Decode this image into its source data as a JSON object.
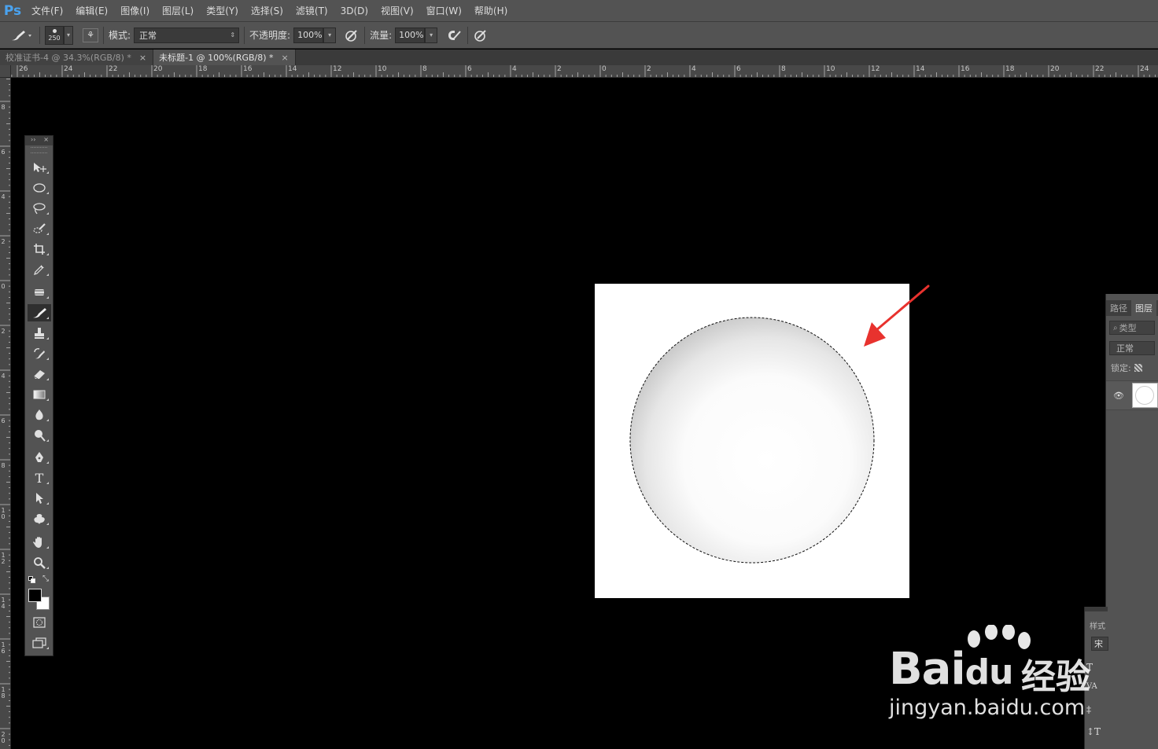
{
  "app": {
    "logo": "Ps"
  },
  "menu": [
    "文件(F)",
    "编辑(E)",
    "图像(I)",
    "图层(L)",
    "类型(Y)",
    "选择(S)",
    "滤镜(T)",
    "3D(D)",
    "视图(V)",
    "窗口(W)",
    "帮助(H)"
  ],
  "options": {
    "brush_size": "250",
    "mode_label": "模式:",
    "mode_value": "正常",
    "opacity_label": "不透明度:",
    "opacity_value": "100%",
    "flow_label": "流量:",
    "flow_value": "100%"
  },
  "tabs": [
    {
      "label": "校准证书-4 @ 34.3%(RGB/8) *",
      "close": "×",
      "active": false
    },
    {
      "label": "未标题-1 @ 100%(RGB/8) *",
      "close": "×",
      "active": true
    }
  ],
  "ruler": {
    "top_labels": [
      "26",
      "24",
      "22",
      "20",
      "18",
      "16",
      "14",
      "12",
      "10",
      "8",
      "6",
      "4",
      "2",
      "0",
      "2",
      "4",
      "6",
      "8",
      "10",
      "12",
      "14",
      "16",
      "18",
      "20",
      "22",
      "24"
    ],
    "left_labels": [
      "8",
      "6",
      "4",
      "2",
      "0",
      "2",
      "4",
      "6",
      "8",
      "10",
      "12",
      "14",
      "16",
      "18",
      "20"
    ]
  },
  "toolbox": {
    "header_expand": "››",
    "header_close": "×",
    "active_tool": "brush"
  },
  "layers_panel": {
    "tab_paths": "路径",
    "tab_layers": "图层",
    "kind_label": "类型",
    "blend_mode": "正常",
    "lock_label": "锁定:"
  },
  "char_panel": {
    "tab": "样式",
    "font_field": "宋"
  },
  "watermark": {
    "brand": "Bai",
    "brand2": "du",
    "cn": "经验",
    "url": "jingyan.baidu.com"
  },
  "colors": {
    "ui_bg": "#535353",
    "canvas_bg": "#000000",
    "document": "#ffffff",
    "annotation_arrow": "#e8322e"
  }
}
